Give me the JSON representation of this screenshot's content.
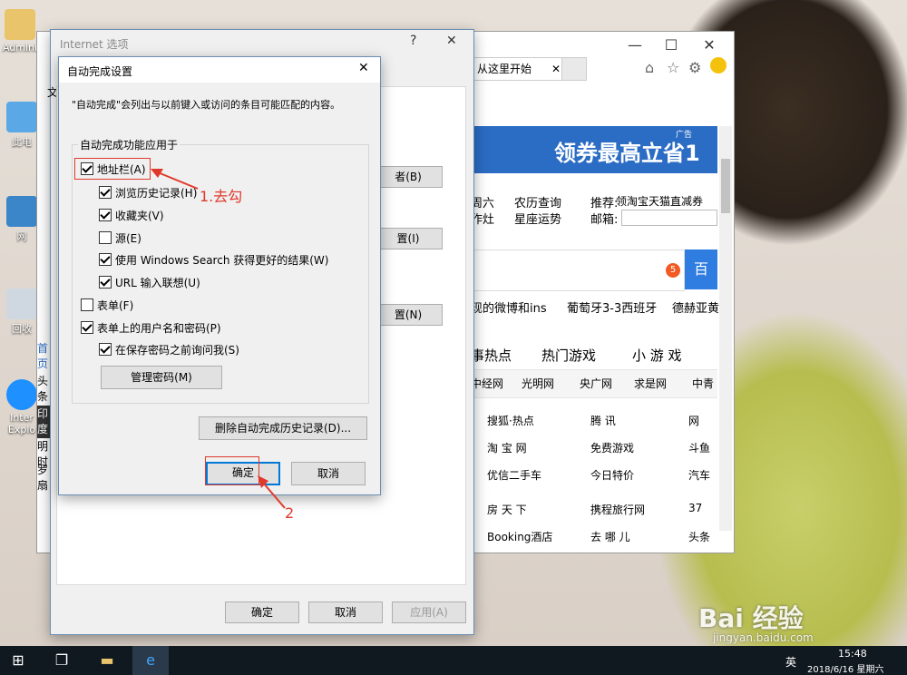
{
  "desktop": {
    "icons": [
      {
        "label": "Admini"
      },
      {
        "label": "此电"
      },
      {
        "label": "网"
      },
      {
        "label": "回收"
      },
      {
        "label": "Inter Explo"
      }
    ]
  },
  "browser": {
    "tab_label": "从这里开始",
    "banner_text": "领券最高立省1",
    "banner_ad": "广告",
    "links_row1": [
      "周六",
      "农历查询",
      "推荐:",
      "领淘宝天猫直减券"
    ],
    "links_row2": [
      "作灶",
      "星座运势",
      "邮箱:"
    ],
    "search_badge": "5",
    "search_btn": "百",
    "hot_row": [
      "现的微博和ins",
      "葡萄牙3-3西班牙",
      "德赫亚黄"
    ],
    "nav_tabs": [
      "事热点",
      "热门游戏",
      "小 游 戏"
    ],
    "news_links": [
      "中经网",
      "光明网",
      "央广网",
      "求是网",
      "中青"
    ],
    "sites": [
      [
        "搜狐·热点",
        "腾 讯",
        "网"
      ],
      [
        "淘 宝 网",
        "免费游戏",
        "斗鱼"
      ],
      [
        "优信二手车",
        "今日特价",
        "汽车"
      ],
      [
        "房 天 下",
        "携程旅行网",
        "37"
      ],
      [
        "Booking酒店",
        "去 哪 儿",
        "头条"
      ]
    ],
    "left_side": [
      "首页",
      "头条",
      "印度",
      "明时",
      "罗扇"
    ]
  },
  "ie_options": {
    "title": "Internet 选项",
    "help": "?",
    "close": "✕",
    "tab_char": "文",
    "side_buttons": [
      "者(B)",
      "置(I)",
      "置(N)"
    ],
    "footer": {
      "ok": "确定",
      "cancel": "取消",
      "apply": "应用(A)"
    }
  },
  "autocomplete": {
    "title": "自动完成设置",
    "close": "✕",
    "description": "\"自动完成\"会列出与以前键入或访问的条目可能匹配的内容。",
    "group_label": "自动完成功能应用于",
    "options": [
      {
        "label": "地址栏(A)",
        "checked": true,
        "indent": 0
      },
      {
        "label": "浏览历史记录(H)",
        "checked": true,
        "indent": 1
      },
      {
        "label": "收藏夹(V)",
        "checked": true,
        "indent": 1
      },
      {
        "label": "源(E)",
        "checked": false,
        "indent": 1
      },
      {
        "label": "使用 Windows Search 获得更好的结果(W)",
        "checked": true,
        "indent": 1
      },
      {
        "label": "URL 输入联想(U)",
        "checked": true,
        "indent": 1
      },
      {
        "label": "表单(F)",
        "checked": false,
        "indent": 0
      },
      {
        "label": "表单上的用户名和密码(P)",
        "checked": true,
        "indent": 0
      },
      {
        "label": "在保存密码之前询问我(S)",
        "checked": true,
        "indent": 1
      }
    ],
    "manage_passwords": "管理密码(M)",
    "delete_history": "删除自动完成历史记录(D)...",
    "ok": "确定",
    "cancel": "取消"
  },
  "annotations": {
    "step1": "1.去勾",
    "step2": "2"
  },
  "taskbar": {
    "time": "15:48",
    "date": "2018/6/16 星期六",
    "ime": "英"
  },
  "watermark": {
    "logo": "Bai 经验",
    "url": "jingyan.baidu.com"
  },
  "colors": {
    "accent": "#0078d7",
    "annotation_red": "#e0392b",
    "banner_blue": "#2b6cc4"
  }
}
